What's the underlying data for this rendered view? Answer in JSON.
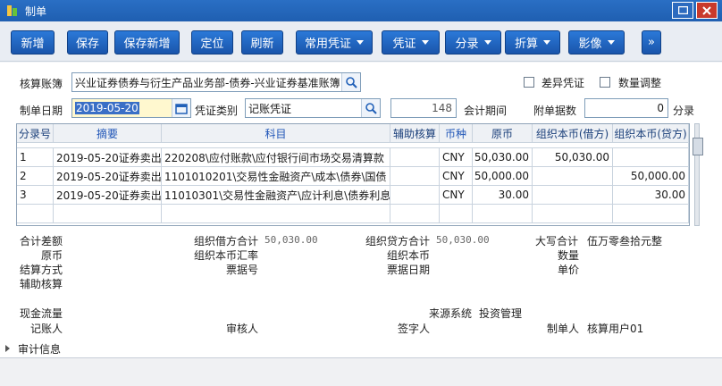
{
  "window": {
    "title": "制单"
  },
  "toolbar": {
    "add": "新增",
    "save": "保存",
    "save_new": "保存新增",
    "locate": "定位",
    "refresh": "刷新",
    "common_voucher": "常用凭证",
    "voucher": "凭证",
    "entry": "分录",
    "convert": "折算",
    "image": "影像",
    "more": "»"
  },
  "form": {
    "ledger_label": "核算账簿",
    "ledger_value": "兴业证券债券与衍生产品业务部-债券-兴业证券基准账簿",
    "diff_voucher_label": "差异凭证",
    "qty_adjust_label": "数量调整",
    "date_label": "制单日期",
    "date_value": "2019-05-20",
    "voucher_type_label": "凭证类别",
    "voucher_type_value": "记账凭证",
    "voucher_no": "148",
    "period_label": "会计期间",
    "attach_label": "附单据数",
    "attach_value": "0",
    "attach_unit": "分录"
  },
  "grid": {
    "headers": [
      "分录号",
      "摘要",
      "科目",
      "辅助核算",
      "币种",
      "原币",
      "组织本币(借方)",
      "组织本币(贷方)"
    ],
    "rows": [
      [
        "1",
        "2019-05-20证券卖出",
        "220208\\应付账款\\应付银行间市场交易清算款",
        "",
        "CNY",
        "50,030.00",
        "50,030.00",
        ""
      ],
      [
        "2",
        "2019-05-20证券卖出",
        "1101010201\\交易性金融资产\\成本\\债券\\国债",
        "",
        "CNY",
        "50,000.00",
        "",
        "50,000.00"
      ],
      [
        "3",
        "2019-05-20证券卖出",
        "11010301\\交易性金融资产\\应计利息\\债券利息",
        "",
        "CNY",
        "30.00",
        "",
        "30.00"
      ]
    ]
  },
  "footer": {
    "total_diff_label": "合计差额",
    "debit_total_label": "组织借方合计",
    "debit_total_value": "50,030.00",
    "credit_total_label": "组织贷方合计",
    "credit_total_value": "50,030.00",
    "uppercase_label": "大写合计",
    "uppercase_value": "伍万零叁拾元整",
    "orig_currency_label": "原币",
    "rate_label": "组织本币汇率",
    "org_currency_label": "组织本币",
    "qty_label": "数量",
    "settle_label": "结算方式",
    "ticket_no_label": "票据号",
    "ticket_date_label": "票据日期",
    "price_label": "单价",
    "aux_label": "辅助核算",
    "cashflow_label": "现金流量",
    "source_label": "来源系统",
    "source_value": "投资管理",
    "bookkeeper_label": "记账人",
    "auditor_label": "审核人",
    "signer_label": "签字人",
    "maker_label": "制单人",
    "maker_value": "核算用户01",
    "audit_info_label": "审计信息"
  }
}
